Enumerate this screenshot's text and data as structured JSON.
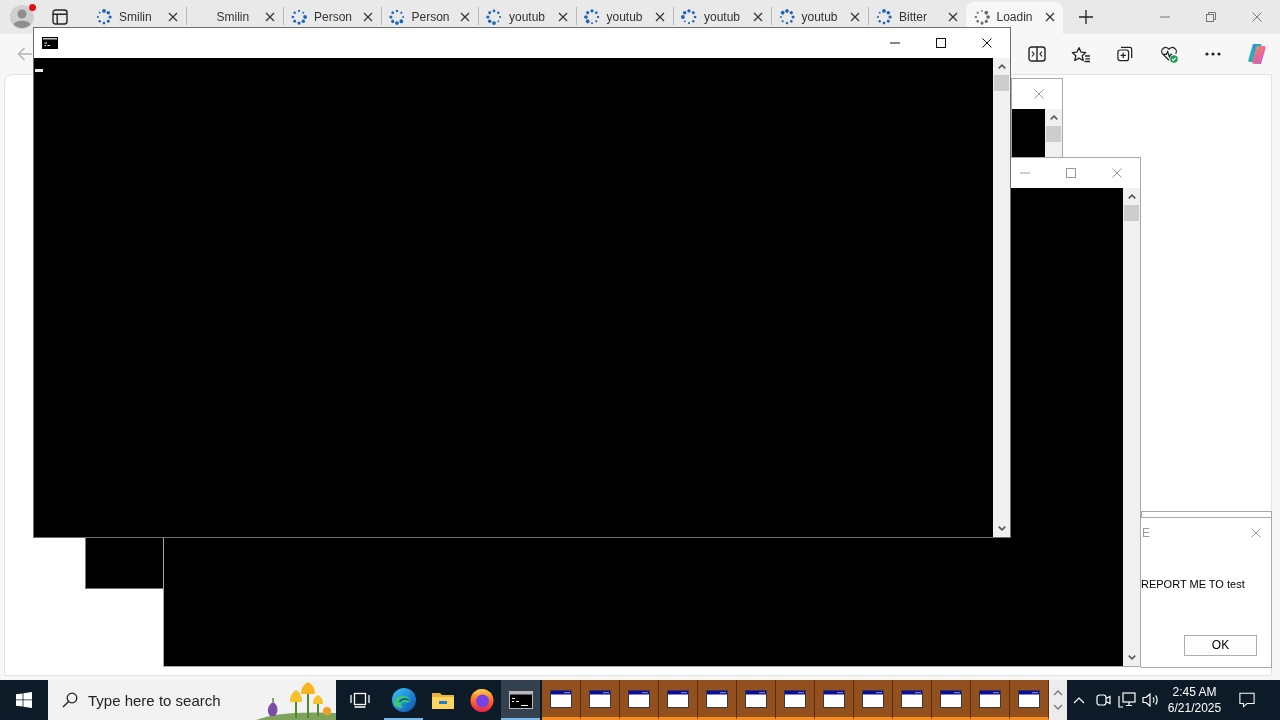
{
  "browser": {
    "profile": {
      "notification": true
    },
    "tabs": [
      {
        "title": "Smilin",
        "loading": true,
        "selected": false
      },
      {
        "title": "Smilin",
        "loading": false,
        "selected": false
      },
      {
        "title": "Person",
        "loading": true,
        "selected": false
      },
      {
        "title": "Person",
        "loading": true,
        "selected": false
      },
      {
        "title": "youtub",
        "loading": true,
        "selected": false
      },
      {
        "title": "youtub",
        "loading": true,
        "selected": false
      },
      {
        "title": "youtub",
        "loading": true,
        "selected": false
      },
      {
        "title": "youtub",
        "loading": true,
        "selected": false
      },
      {
        "title": "Bitter",
        "loading": true,
        "selected": false
      },
      {
        "title": "Loadin",
        "loading": true,
        "selected": true
      }
    ]
  },
  "console_window": {
    "active": true
  },
  "message_box": {
    "title": "E",
    "message": "REPORT ME TO test",
    "button": "OK",
    "active": false
  },
  "taskbar": {
    "search": {
      "placeholder": "Type here to search"
    },
    "apps": [
      {
        "kind": "taskview",
        "running": false,
        "selected": false
      },
      {
        "kind": "swirl",
        "running": true,
        "selected": false
      },
      {
        "kind": "folder",
        "running": false,
        "selected": false
      },
      {
        "kind": "flame",
        "running": false,
        "selected": false
      },
      {
        "kind": "terminal",
        "running": true,
        "selected": true
      }
    ],
    "windows": [
      {
        "flashing": true
      },
      {
        "flashing": true
      },
      {
        "flashing": true
      },
      {
        "flashing": true
      },
      {
        "flashing": true
      },
      {
        "flashing": true
      },
      {
        "flashing": true
      },
      {
        "flashing": true
      },
      {
        "flashing": true
      },
      {
        "flashing": true
      },
      {
        "flashing": true
      },
      {
        "flashing": true
      },
      {
        "flashing": true
      }
    ],
    "clock": {
      "time": "2:45 AM",
      "date": "6/21/2025"
    }
  }
}
